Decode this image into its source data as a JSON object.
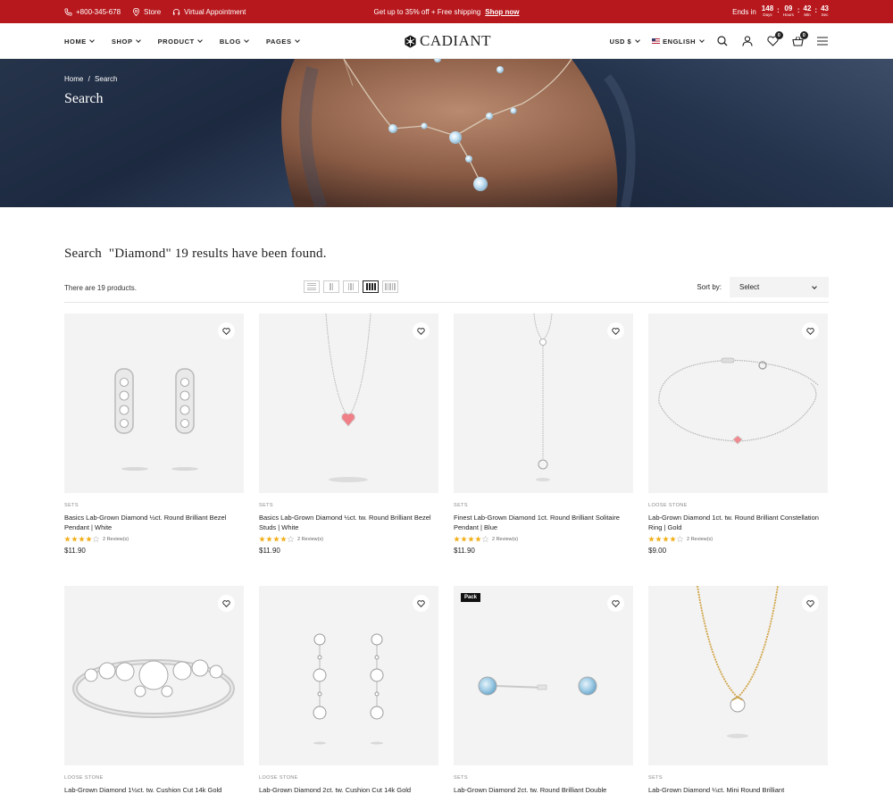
{
  "topbar": {
    "phone": "+800-345-678",
    "store": "Store",
    "appointment": "Virtual Appointment",
    "promo": "Get up to 35% off + Free shipping",
    "promo_link": "Shop now",
    "ends_in": "Ends in",
    "countdown": [
      {
        "value": "148",
        "label": "Days"
      },
      {
        "value": "09",
        "label": "Hours"
      },
      {
        "value": "42",
        "label": "Min"
      },
      {
        "value": "43",
        "label": "Sec"
      }
    ],
    "bg_color": "#b7181d"
  },
  "header": {
    "nav": [
      "HOME",
      "SHOP",
      "PRODUCT",
      "BLOG",
      "PAGES"
    ],
    "logo": "CADIANT",
    "currency": "USD $",
    "language": "ENGLISH",
    "wishlist_count": "0",
    "cart_count": "0"
  },
  "banner": {
    "breadcrumb_home": "Home",
    "breadcrumb_sep": "/",
    "breadcrumb_current": "Search",
    "title": "Search"
  },
  "results": {
    "heading": "Search  \"Diamond\" 19 results have been found.",
    "count_text": "There are 19 products.",
    "sort_label": "Sort by:",
    "sort_value": "Select"
  },
  "products": [
    {
      "category": "SETS",
      "name": "Basics Lab-Grown Diamond ½ct. Round Brilliant Bezel Pendant | White",
      "rating": 4,
      "reviews": "2 Review(s)",
      "price": "$11.90",
      "tag": ""
    },
    {
      "category": "SETS",
      "name": "Basics Lab-Grown Diamond ½ct. tw. Round Brilliant Bezel Studs | White",
      "rating": 4,
      "reviews": "2 Review(s)",
      "price": "$11.90",
      "tag": ""
    },
    {
      "category": "SETS",
      "name": "Finest Lab-Grown Diamond 1ct. Round Brilliant Solitaire Pendant | Blue",
      "rating": 4,
      "reviews": "2 Review(s)",
      "price": "$11.90",
      "tag": ""
    },
    {
      "category": "LOOSE STONE",
      "name": "Lab-Grown Diamond 1ct. tw. Round Brilliant Constellation Ring | Gold",
      "rating": 4,
      "reviews": "2 Review(s)",
      "price": "$9.00",
      "tag": ""
    },
    {
      "category": "LOOSE STONE",
      "name": "Lab-Grown Diamond 1½ct. tw. Cushion Cut 14k Gold",
      "rating": 0,
      "reviews": "",
      "price": "",
      "tag": ""
    },
    {
      "category": "LOOSE STONE",
      "name": "Lab-Grown Diamond 2ct. tw. Cushion Cut 14k Gold",
      "rating": 0,
      "reviews": "",
      "price": "",
      "tag": ""
    },
    {
      "category": "SETS",
      "name": "Lab-Grown Diamond 2ct. tw. Round Brilliant Double",
      "rating": 0,
      "reviews": "",
      "price": "",
      "tag": "Pack"
    },
    {
      "category": "SETS",
      "name": "Lab-Grown Diamond ¼ct. Mini Round Brilliant",
      "rating": 0,
      "reviews": "",
      "price": "",
      "tag": ""
    }
  ]
}
